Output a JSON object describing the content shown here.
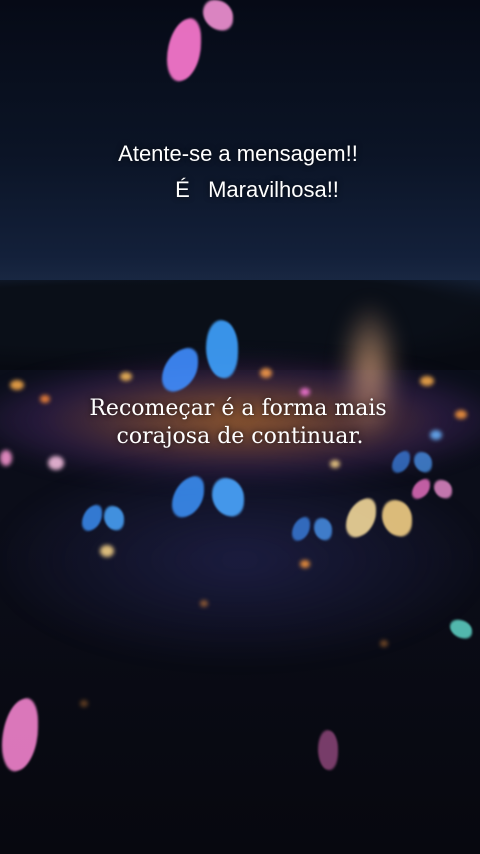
{
  "overlay": {
    "line1": "Atente-se a mensagem!!",
    "line2": "É   Maravilhosa!!"
  },
  "quote": {
    "line1": "Recomeçar é a forma mais",
    "line2": "corajosa de continuar."
  },
  "colors": {
    "butterfly_blue": "#3fa2ff",
    "butterfly_pink": "#ff6fd0",
    "butterfly_gold": "#ffd98a",
    "field_orange": "#ff9b3d"
  }
}
